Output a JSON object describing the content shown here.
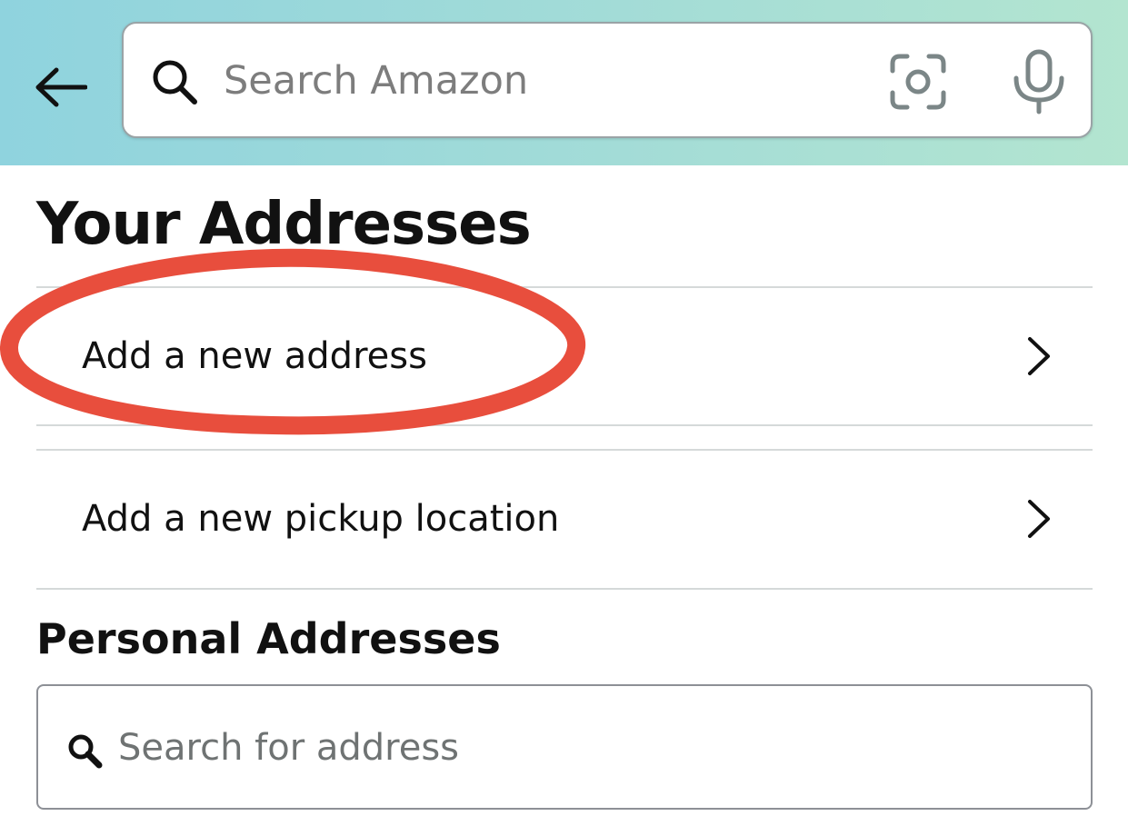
{
  "header": {
    "search": {
      "placeholder": "Search Amazon"
    },
    "icons": {
      "back": "back-arrow-icon",
      "search": "search-icon",
      "camera": "camera-lens-icon",
      "mic": "microphone-icon"
    },
    "colors": {
      "gradient_start": "#8fd3de",
      "gradient_end": "#b3e5d0"
    }
  },
  "page": {
    "title": "Your Addresses"
  },
  "actions": [
    {
      "label": "Add a new address",
      "icon": "chevron-right-icon"
    },
    {
      "label": "Add a new pickup location",
      "icon": "chevron-right-icon"
    }
  ],
  "personal": {
    "title": "Personal Addresses",
    "search_placeholder": "Search for address"
  },
  "annotation": {
    "type": "red-ellipse-highlight",
    "target": "Add a new address",
    "color": "#e84e3d"
  }
}
